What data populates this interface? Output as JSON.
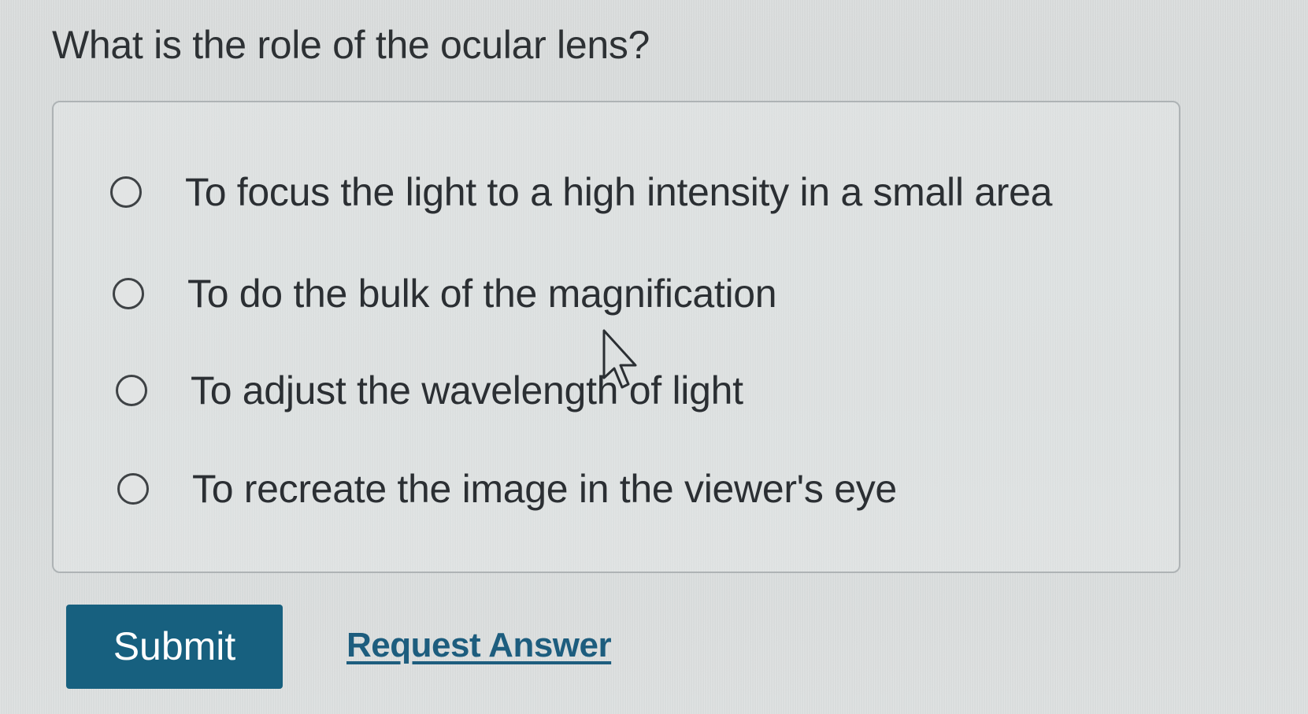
{
  "question": {
    "text": "What is the role of the ocular lens?"
  },
  "options": [
    {
      "label": "To focus the light to a high intensity in a small area",
      "selected": false
    },
    {
      "label": "To do the bulk of the magnification",
      "selected": false
    },
    {
      "label": "To adjust the wavelength of light",
      "selected": false
    },
    {
      "label": "To recreate the image in the viewer's eye",
      "selected": false
    }
  ],
  "actions": {
    "submit_label": "Submit",
    "request_answer_label": "Request Answer"
  },
  "colors": {
    "submit_bg": "#17607f",
    "link": "#1d5d7e",
    "text": "#2b2f33"
  },
  "icons": {
    "cursor": "mouse-pointer-icon",
    "radio": "radio-unchecked-icon"
  }
}
